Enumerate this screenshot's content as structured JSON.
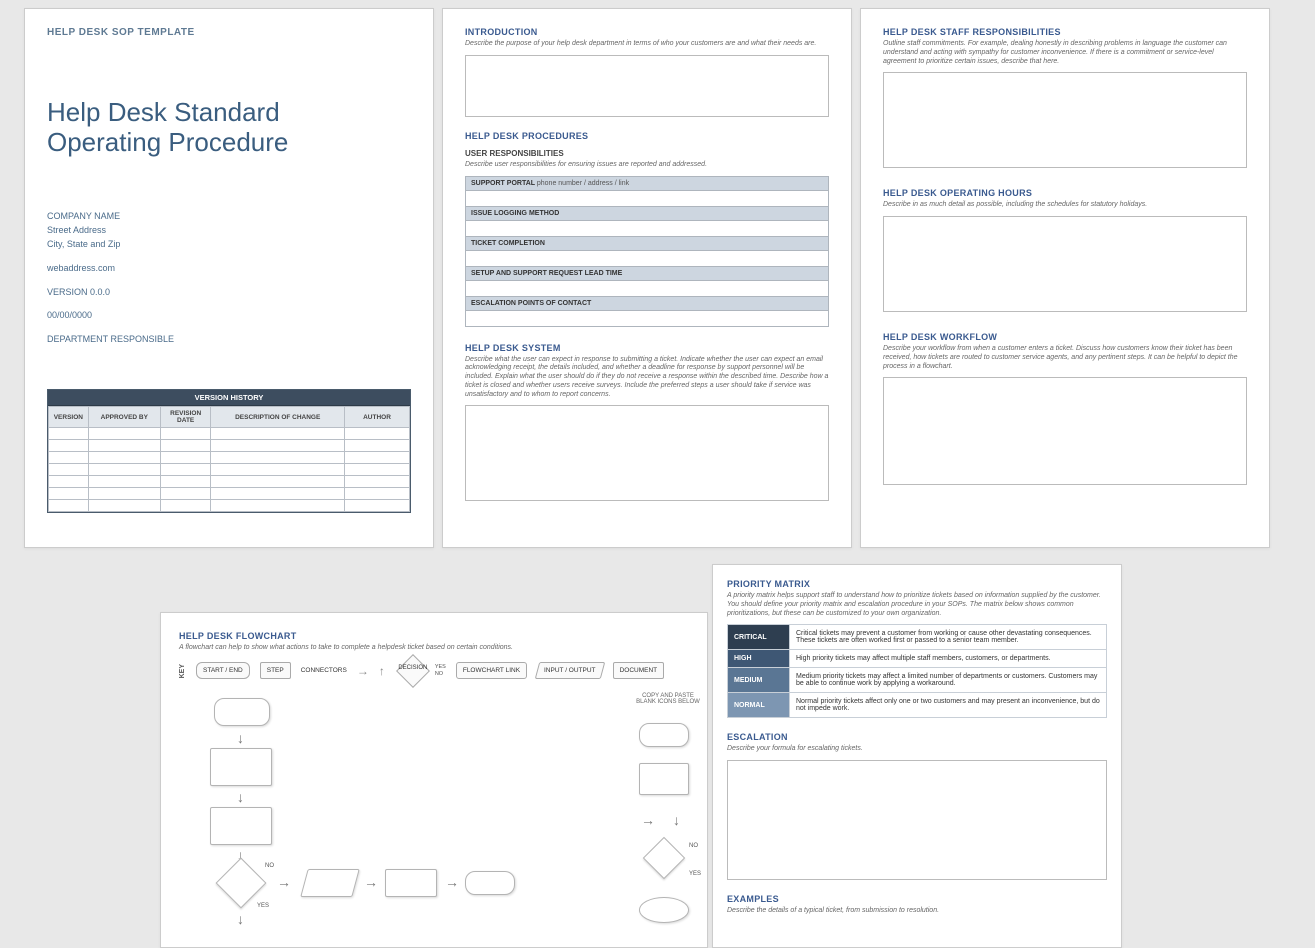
{
  "page1": {
    "doc_label": "HELP DESK SOP TEMPLATE",
    "title1": "Help Desk Standard",
    "title2": "Operating Procedure",
    "company": "COMPANY NAME",
    "street": "Street Address",
    "city": "City, State and Zip",
    "web": "webaddress.com",
    "version": "VERSION 0.0.0",
    "date": "00/00/0000",
    "dept": "DEPARTMENT RESPONSIBLE",
    "vh_title": "VERSION HISTORY",
    "vh_cols": [
      "VERSION",
      "APPROVED BY",
      "REVISION DATE",
      "DESCRIPTION OF CHANGE",
      "AUTHOR"
    ]
  },
  "page2": {
    "intro_h": "INTRODUCTION",
    "intro_d": "Describe the purpose of your help desk department in terms of who your customers are and what their needs are.",
    "proc_h": "HELP DESK PROCEDURES",
    "user_h": "USER RESPONSIBILITIES",
    "user_d": "Describe user responsibilities for ensuring issues are reported and addressed.",
    "rows": [
      {
        "label": "SUPPORT PORTAL",
        "sub": "phone number / address / link"
      },
      {
        "label": "ISSUE LOGGING METHOD",
        "sub": ""
      },
      {
        "label": "TICKET COMPLETION",
        "sub": ""
      },
      {
        "label": "SETUP AND SUPPORT REQUEST LEAD TIME",
        "sub": ""
      },
      {
        "label": "ESCALATION POINTS OF CONTACT",
        "sub": ""
      }
    ],
    "sys_h": "HELP DESK SYSTEM",
    "sys_d": "Describe what the user can expect in response to submitting a ticket. Indicate whether the user can expect an email acknowledging receipt, the details included, and whether a deadline for response by support personnel will be included. Explain what the user should do if they do not receive a response within the described time. Describe how a ticket is closed and whether users receive surveys. Include the preferred steps a user should take if service was unsatisfactory and to whom to report concerns."
  },
  "page3": {
    "resp_h": "HELP DESK STAFF RESPONSIBILITIES",
    "resp_d": "Outline staff commitments. For example, dealing honestly in describing problems in language the customer can understand and acting with sympathy for customer inconvenience. If there is a commitment or service-level agreement to prioritize certain issues, describe that here.",
    "hrs_h": "HELP DESK OPERATING HOURS",
    "hrs_d": "Describe in as much detail as possible, including the schedules for statutory holidays.",
    "wf_h": "HELP DESK WORKFLOW",
    "wf_d": "Describe your workflow from when a customer enters a ticket. Discuss how customers know their ticket has been received, how tickets are routed to customer service agents, and any pertinent steps. It can be helpful to depict the process in a flowchart."
  },
  "page4": {
    "fc_h": "HELP DESK FLOWCHART",
    "fc_d": "A flowchart can help to show what actions to take to complete a helpdesk ticket based on certain conditions.",
    "key_label": "KEY",
    "k1": "START / END",
    "k2": "STEP",
    "k3": "CONNECTORS",
    "k4": "DECISION",
    "k4y": "YES",
    "k4n": "NO",
    "k5": "FLOWCHART LINK",
    "k6": "INPUT / OUTPUT",
    "k7": "DOCUMENT",
    "paste": "COPY AND PASTE BLANK ICONS BELOW",
    "no": "NO",
    "yes": "YES"
  },
  "page5": {
    "pm_h": "PRIORITY MATRIX",
    "pm_d": "A priority matrix helps support staff to understand how to prioritize tickets based on information supplied by the customer. You should define your priority matrix and escalation procedure in your SOPs. The matrix below shows common prioritizations, but these can be customized to your own organization.",
    "rows": [
      {
        "label": "CRITICAL",
        "cls": "pm-crit",
        "desc": "Critical tickets may prevent a customer from working or cause other devastating consequences. These tickets are often worked first or passed to a senior team member."
      },
      {
        "label": "HIGH",
        "cls": "pm-high",
        "desc": "High priority tickets may affect multiple staff members, customers, or departments."
      },
      {
        "label": "MEDIUM",
        "cls": "pm-med",
        "desc": "Medium priority tickets may affect a limited number of departments or customers. Customers may be able to continue work by applying a workaround."
      },
      {
        "label": "NORMAL",
        "cls": "pm-norm",
        "desc": "Normal priority tickets affect only one or two customers and may present an inconvenience, but do not impede work."
      }
    ],
    "esc_h": "ESCALATION",
    "esc_d": "Describe your formula for escalating tickets.",
    "ex_h": "EXAMPLES",
    "ex_d": "Describe the details of a typical ticket, from submission to resolution."
  }
}
